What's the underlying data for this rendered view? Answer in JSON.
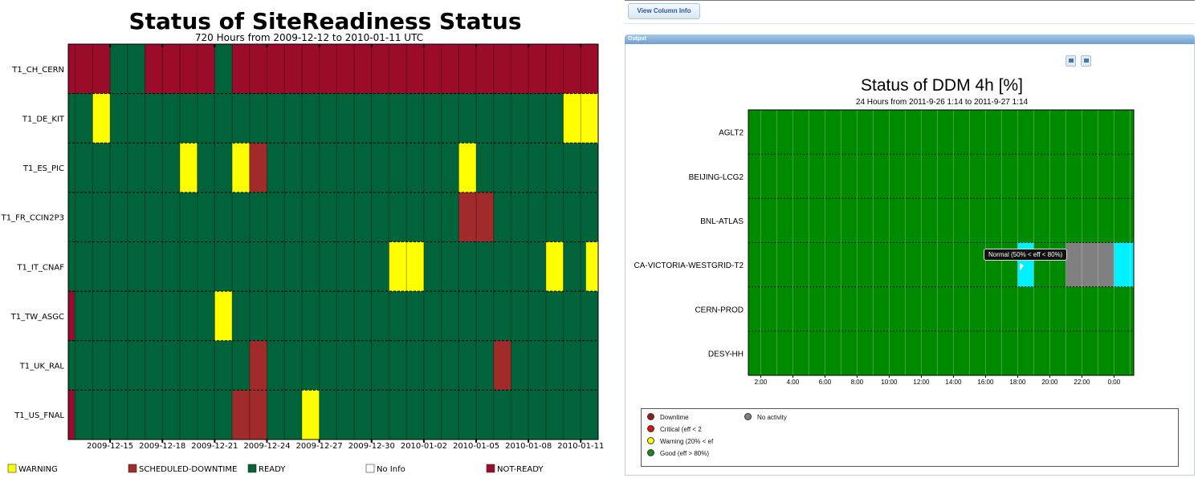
{
  "left_chart": {
    "title": "Status of SiteReadiness Status",
    "subtitle": "720 Hours from 2009-12-12 to 2010-01-11 UTC",
    "colors": {
      "READY": "#00633a",
      "NOT-READY": "#9b0b2a",
      "WARNING": "#ffff00",
      "SCHEDULED-DOWNTIME": "#a12b2b",
      "No Info": "#ffffff"
    },
    "legend": [
      {
        "label": "WARNING",
        "state": "WARNING"
      },
      {
        "label": "SCHEDULED-DOWNTIME",
        "state": "SCHEDULED-DOWNTIME"
      },
      {
        "label": "READY",
        "state": "READY"
      },
      {
        "label": "No Info",
        "state": "No Info"
      },
      {
        "label": "NOT-READY",
        "state": "NOT-READY"
      }
    ]
  },
  "right_panel": {
    "view_column_button": "View Column Info",
    "output_header": "Output",
    "tooltip": "Normal (50% < eff < 80%)",
    "legend": [
      {
        "label": "Downtime",
        "color": "#8b1f1f"
      },
      {
        "label": "Critical (eff < 2",
        "color": "#e01010"
      },
      {
        "label": "Warning (20% < ef",
        "color": "#ffff00"
      },
      {
        "label": "Good (eff > 80%)",
        "color": "#1a8a1a"
      },
      {
        "label": "No activity",
        "color": "#808080"
      }
    ]
  },
  "chart_data": [
    {
      "type": "heatmap",
      "title": "Status of SiteReadiness Status",
      "subtitle": "720 Hours from 2009-12-12 to 2010-01-11 UTC",
      "x_start": "2009-12-12",
      "x_end": "2010-01-11",
      "x_unit": "day",
      "x_tick_labels": [
        "2009-12-15",
        "2009-12-18",
        "2009-12-21",
        "2009-12-24",
        "2009-12-27",
        "2009-12-30",
        "2010-01-02",
        "2010-01-05",
        "2010-01-08",
        "2010-01-11"
      ],
      "default_state": "READY",
      "rows": [
        {
          "site": "T1_CH_CERN",
          "events": [
            {
              "state": "NOT-READY",
              "from": 0,
              "to": 2.4
            },
            {
              "state": "NOT-READY",
              "from": 4.4,
              "to": 8.4
            },
            {
              "state": "NOT-READY",
              "from": 9.4,
              "to": 30.4
            }
          ]
        },
        {
          "site": "T1_DE_KIT",
          "events": [
            {
              "state": "WARNING",
              "from": 1.4,
              "to": 2.4
            },
            {
              "state": "WARNING",
              "from": 28.4,
              "to": 30.4
            }
          ]
        },
        {
          "site": "T1_ES_PIC",
          "events": [
            {
              "state": "WARNING",
              "from": 6.4,
              "to": 7.4
            },
            {
              "state": "WARNING",
              "from": 9.4,
              "to": 10.4
            },
            {
              "state": "SCHEDULED-DOWNTIME",
              "from": 10.4,
              "to": 11.4
            },
            {
              "state": "WARNING",
              "from": 22.4,
              "to": 23.4
            }
          ]
        },
        {
          "site": "T1_FR_CCIN2P3",
          "events": [
            {
              "state": "SCHEDULED-DOWNTIME",
              "from": 22.4,
              "to": 24.4
            }
          ]
        },
        {
          "site": "T1_IT_CNAF",
          "events": [
            {
              "state": "WARNING",
              "from": 18.4,
              "to": 20.4
            },
            {
              "state": "WARNING",
              "from": 27.4,
              "to": 28.4
            },
            {
              "state": "WARNING",
              "from": 29.7,
              "to": 30.4
            }
          ]
        },
        {
          "site": "T1_TW_ASGC",
          "events": [
            {
              "state": "NOT-READY",
              "from": 0,
              "to": 0.35
            },
            {
              "state": "WARNING",
              "from": 8.4,
              "to": 9.4
            }
          ]
        },
        {
          "site": "T1_UK_RAL",
          "events": [
            {
              "state": "SCHEDULED-DOWNTIME",
              "from": 10.4,
              "to": 11.4
            },
            {
              "state": "SCHEDULED-DOWNTIME",
              "from": 24.4,
              "to": 25.4
            }
          ]
        },
        {
          "site": "T1_US_FNAL",
          "events": [
            {
              "state": "NOT-READY",
              "from": 0,
              "to": 0.35
            },
            {
              "state": "SCHEDULED-DOWNTIME",
              "from": 9.4,
              "to": 11.4
            },
            {
              "state": "WARNING",
              "from": 13.4,
              "to": 14.4
            }
          ]
        }
      ]
    },
    {
      "type": "heatmap",
      "title": "Status of DDM 4h [%]",
      "subtitle": "24 Hours from 2011-9-26 1:14 to 2011-9-27 1:14",
      "x_tick_labels": [
        "2:00",
        "4:00",
        "6:00",
        "8:00",
        "10:00",
        "12:00",
        "14:00",
        "16:00",
        "18:00",
        "20:00",
        "22:00",
        "0:00"
      ],
      "hour_start": 1.23,
      "hour_end": 25.23,
      "colors": {
        "Good": "#008a00",
        "Normal": "#00f0ff",
        "No activity": "#808080"
      },
      "default_state": "Good",
      "rows": [
        {
          "site": "AGLT2",
          "events": []
        },
        {
          "site": "BEIJING-LCG2",
          "events": []
        },
        {
          "site": "BNL-ATLAS",
          "events": []
        },
        {
          "site": "CA-VICTORIA-WESTGRID-T2",
          "events": [
            {
              "state": "Normal",
              "from": 18.0,
              "to": 19.0
            },
            {
              "state": "No activity",
              "from": 21.0,
              "to": 24.0
            },
            {
              "state": "Normal",
              "from": 24.0,
              "to": 25.23
            }
          ]
        },
        {
          "site": "CERN-PROD",
          "events": []
        },
        {
          "site": "DESY-HH",
          "events": []
        }
      ]
    }
  ]
}
